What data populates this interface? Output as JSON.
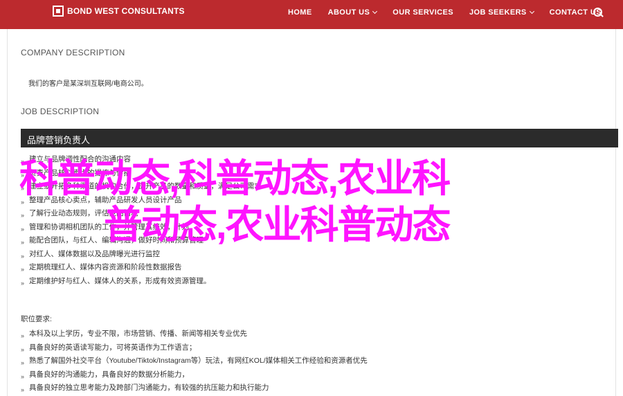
{
  "brand": {
    "name": "BOND WEST CONSULTANTS",
    "tagline": "",
    "primary_color": "#bc2a2e"
  },
  "nav": {
    "items": [
      {
        "label": "HOME",
        "has_dropdown": false
      },
      {
        "label": "ABOUT US",
        "has_dropdown": true
      },
      {
        "label": "OUR SERVICES",
        "has_dropdown": false
      },
      {
        "label": "JOB SEEKERS",
        "has_dropdown": true
      },
      {
        "label": "CONTACT US",
        "has_dropdown": false
      }
    ],
    "search_icon": "search-icon"
  },
  "company": {
    "heading": "COMPANY DESCRIPTION",
    "text": "我们的客户是某深圳互联网/电商公司。"
  },
  "job": {
    "heading": "JOB DESCRIPTION",
    "title": "品牌营销负责人",
    "duties": [
      "建立与品牌调性配合的沟通内容",
      "负责产品核心卖点的提炼与传播",
      "建立或开拓多种渠道的机构合作，提升产品的数量和质量，满足公司需求",
      "整理产品核心卖点，辅助产品研发人员设计产品",
      "了解行业动态规则，评估竞品情况",
      "管理和协调相机团队的工作，并管理其绩效，计划",
      "能配合团队，与红人、编辑沟通，做好时间和预算管理",
      "对红人、媒体数据以及品牌曝光进行监控",
      "定期梳理红人、媒体内容资源和阶段性数据报告",
      "定期维护好与红人、媒体人的关系，形成有效资源管理。"
    ],
    "requirements_label": "职位要求:",
    "requirements": [
      "本科及以上学历，专业不限，市场营销、传播、新闻等相关专业优先",
      "具备良好的英语读写能力，可将英语作为工作语言；",
      "熟悉了解国外社交平台（Youtube/Tiktok/Instagram等）玩法，有网红KOL/媒体相关工作经验和资源者优先",
      "具备良好的沟通能力，具备良好的数据分析能力，",
      "具备良好的独立思考能力及跨部门沟通能力，有较强的抗压能力和执行能力"
    ]
  },
  "overlay": {
    "lines": [
      "科普动态,科普动态,农业科",
      "普动态,农业科普动态"
    ],
    "color": "#ff14ff"
  }
}
